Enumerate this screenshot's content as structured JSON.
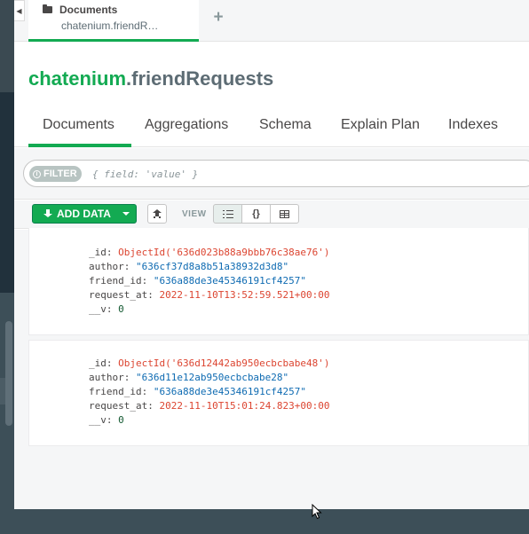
{
  "tabs": {
    "active_title": "Documents",
    "active_subtitle": "chatenium.friendR…",
    "add_label": "+"
  },
  "collection": {
    "db": "chatenium",
    "name": ".friendRequests"
  },
  "subtabs": {
    "items": [
      "Documents",
      "Aggregations",
      "Schema",
      "Explain Plan",
      "Indexes"
    ]
  },
  "filter": {
    "pill_label": "FILTER",
    "placeholder": "{ field: 'value' }"
  },
  "toolbar": {
    "add_data_label": "ADD DATA",
    "view_label": "VIEW",
    "json_view_label": "{}"
  },
  "documents": [
    {
      "id_key": "_id:",
      "id_val": "ObjectId('636d023b88a9bbb76c38ae76')",
      "author_key": "author:",
      "author_val": "\"636cf37d8a8b51a38932d3d8\"",
      "friend_key": "friend_id:",
      "friend_val": "\"636a88de3e45346191cf4257\"",
      "req_key": "request_at:",
      "req_val": "2022-11-10T13:52:59.521+00:00",
      "v_key": "__v:",
      "v_val": "0"
    },
    {
      "id_key": "_id:",
      "id_val": "ObjectId('636d12442ab950ecbcbabe48')",
      "author_key": "author:",
      "author_val": "\"636d11e12ab950ecbcbabe28\"",
      "friend_key": "friend_id:",
      "friend_val": "\"636a88de3e45346191cf4257\"",
      "req_key": "request_at:",
      "req_val": "2022-11-10T15:01:24.823+00:00",
      "v_key": "__v:",
      "v_val": "0"
    }
  ],
  "colors": {
    "accent": "#13aa52",
    "oid": "#dc4531",
    "string": "#0f6bb2",
    "sidebar": "#3d4f58"
  }
}
